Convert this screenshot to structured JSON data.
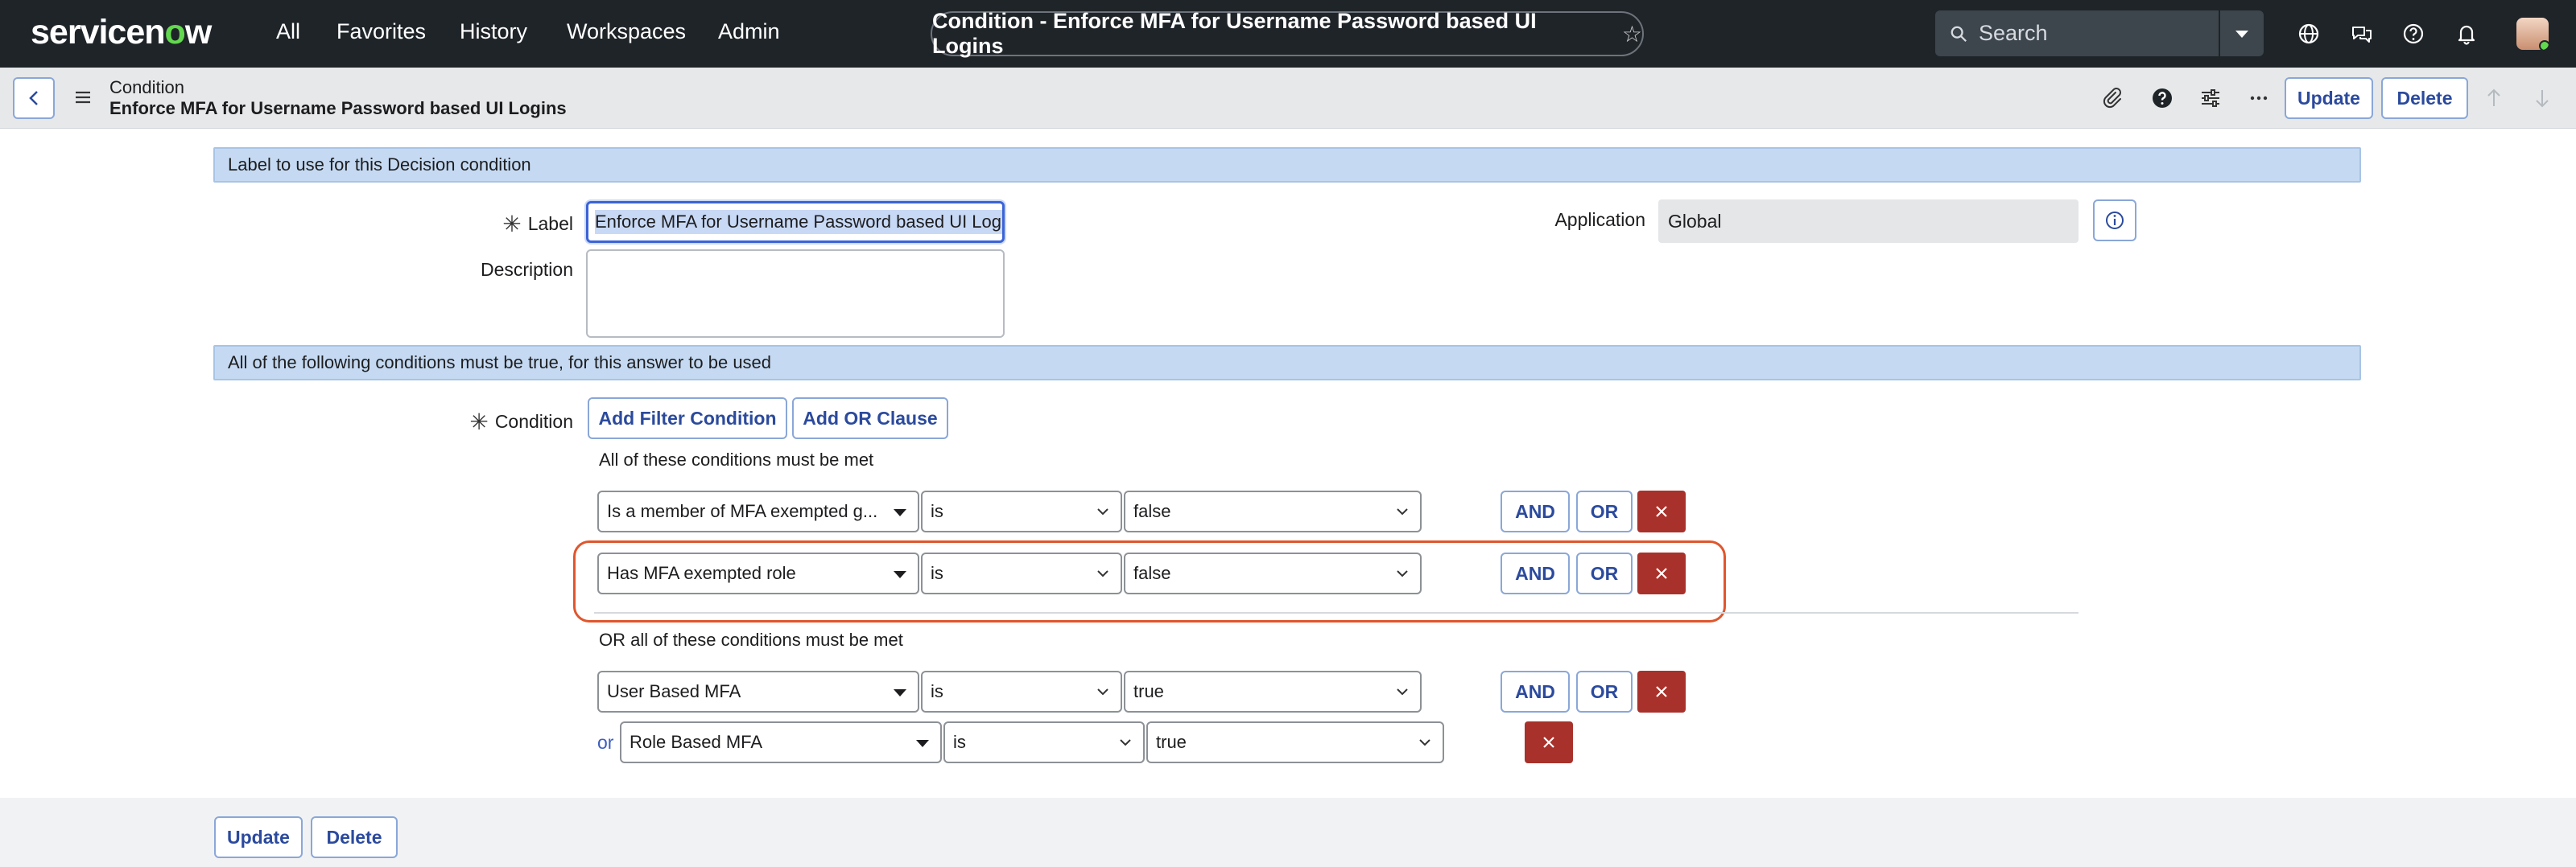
{
  "topnav": {
    "logo_pre": "servicen",
    "logo_o": "o",
    "logo_post": "w",
    "items": [
      "All",
      "Favorites",
      "History",
      "Workspaces",
      "Admin"
    ],
    "record_title": "Condition - Enforce MFA for Username Password based UI Logins",
    "search_placeholder": "Search"
  },
  "form_header": {
    "record_type": "Condition",
    "record_name": "Enforce MFA for Username Password based UI Logins",
    "update_label": "Update",
    "delete_label": "Delete"
  },
  "section1": {
    "title": "Label to use for this Decision condition",
    "label_field_label": "Label",
    "label_value": "Enforce MFA for Username Password based UI Logins",
    "description_label": "Description",
    "description_value": "",
    "application_label": "Application",
    "application_value": "Global"
  },
  "section2": {
    "title": "All of the following conditions must be true, for this answer to be used",
    "condition_label": "Condition",
    "add_filter_label": "Add Filter Condition",
    "add_or_label": "Add OR Clause",
    "group1_text": "All of these conditions must be met",
    "group2_text": "OR all of these conditions must be met",
    "or_connector": "or",
    "and_label": "AND",
    "or_label": "OR",
    "rows": [
      {
        "field": "Is a member of MFA exempted g...",
        "operator": "is",
        "value": "false"
      },
      {
        "field": "Has MFA exempted role",
        "operator": "is",
        "value": "false"
      },
      {
        "field": "User Based MFA",
        "operator": "is",
        "value": "true"
      },
      {
        "field": "Role Based MFA",
        "operator": "is",
        "value": "true"
      }
    ]
  },
  "footer": {
    "update_label": "Update",
    "delete_label": "Delete"
  },
  "colors": {
    "nav_bg": "#1f2429",
    "accent_blue": "#2b4a9d",
    "section_bar": "#c5daf2",
    "delete_red": "#a8312b",
    "highlight_orange": "#e0562d",
    "logo_green": "#62d84e"
  }
}
